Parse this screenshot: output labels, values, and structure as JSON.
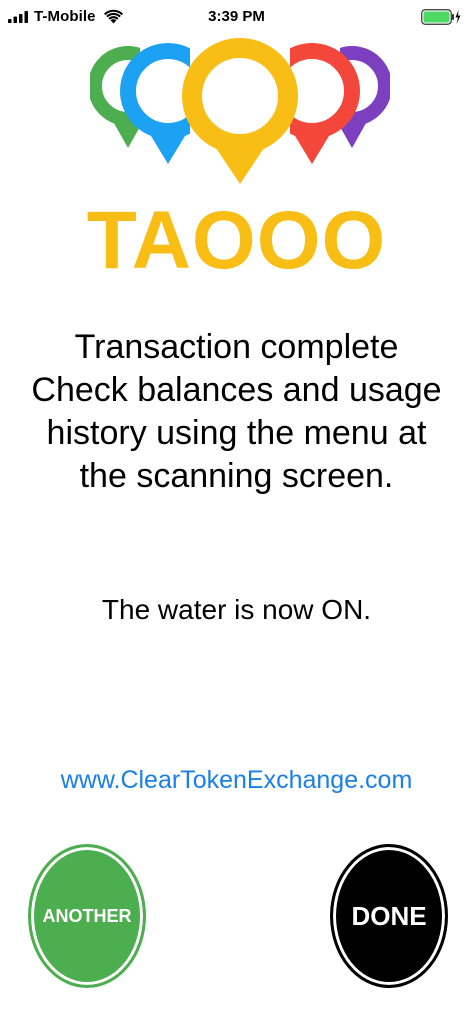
{
  "status_bar": {
    "carrier": "T-Mobile",
    "time": "3:39 PM",
    "signal_icon": "signal-bars-icon",
    "wifi_icon": "wifi-icon",
    "battery_icon": "battery-charging-icon",
    "battery_color": "#4cd964"
  },
  "logo": {
    "brand_name": "TAOOO",
    "brand_color": "#f9be16",
    "pin_colors": [
      "#4cae4f",
      "#1da1f2",
      "#f9be16",
      "#f2473a",
      "#7b3fbf"
    ]
  },
  "message": {
    "lines": [
      "Transaction complete",
      "Check balances and usage",
      "history using the menu at",
      "the scanning screen."
    ]
  },
  "water_status": "The water is now ON.",
  "website": {
    "text": "www.ClearTokenExchange.com",
    "color": "#1a7fe6"
  },
  "buttons": {
    "another_label": "ANOTHER",
    "another_color": "#4cae4f",
    "done_label": "DONE",
    "done_color": "#000000"
  }
}
